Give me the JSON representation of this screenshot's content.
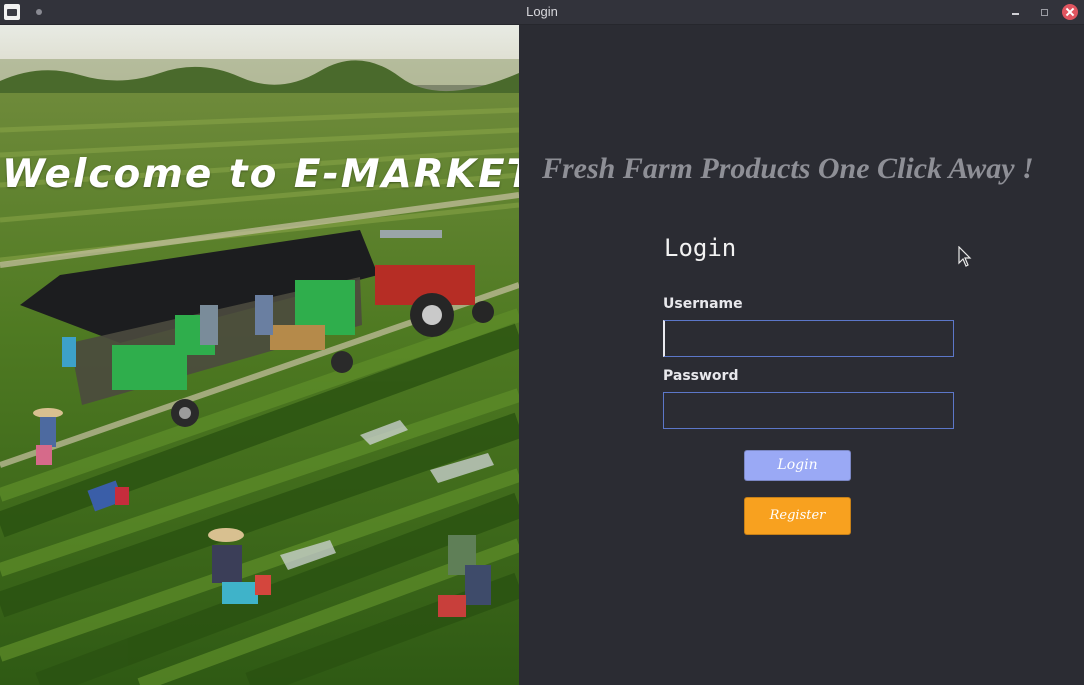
{
  "window": {
    "title": "Login"
  },
  "left_panel": {
    "welcome_text": "Welcome to E-MARKET"
  },
  "right_panel": {
    "tagline": "Fresh Farm Products One Click Away !",
    "form": {
      "heading": "Login",
      "username_label": "Username",
      "username_value": "",
      "password_label": "Password",
      "password_value": "",
      "login_button": "Login",
      "register_button": "Register"
    }
  },
  "colors": {
    "background": "#2b2c33",
    "tagline": "#8e8f96",
    "login_button": "#9aa9f5",
    "register_button": "#f8a11f",
    "field_border": "#5c77c9",
    "close_button": "#e05560"
  },
  "icons": {
    "app_icon": "app-icon",
    "pin": "pin-dot-icon",
    "minimize": "minimize-icon",
    "maximize": "maximize-icon",
    "close": "close-icon",
    "cursor": "mouse-cursor-icon"
  }
}
